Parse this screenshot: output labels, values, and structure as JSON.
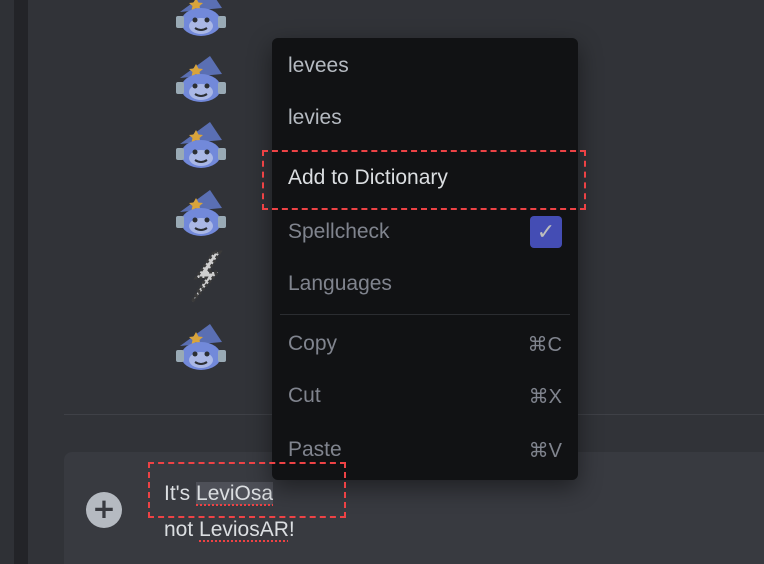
{
  "context_menu": {
    "suggestions": [
      "levees",
      "levies"
    ],
    "add_to_dictionary": "Add to Dictionary",
    "spellcheck": {
      "label": "Spellcheck",
      "checked": true,
      "check_glyph": "✓"
    },
    "languages": "Languages",
    "edit_actions": [
      {
        "label": "Copy",
        "shortcut": "⌘C"
      },
      {
        "label": "Cut",
        "shortcut": "⌘X"
      },
      {
        "label": "Paste",
        "shortcut": "⌘V"
      }
    ]
  },
  "composer": {
    "plus_glyph": "+",
    "line1": {
      "prefix": "It's ",
      "selected_word": "LeviOsa"
    },
    "line2": {
      "prefix": "not ",
      "misspelled_word": "LeviosAR",
      "suffix": "!"
    }
  },
  "avatars": [
    "wizard-avatar-icon",
    "wizard-avatar-icon",
    "wizard-avatar-icon",
    "wizard-avatar-icon",
    "lightning-icon",
    "wizard-avatar-icon"
  ],
  "colors": {
    "accent": "#5865f2",
    "highlight_dash": "#ed4245",
    "menu_background": "#111214",
    "chat_background": "#313338"
  }
}
